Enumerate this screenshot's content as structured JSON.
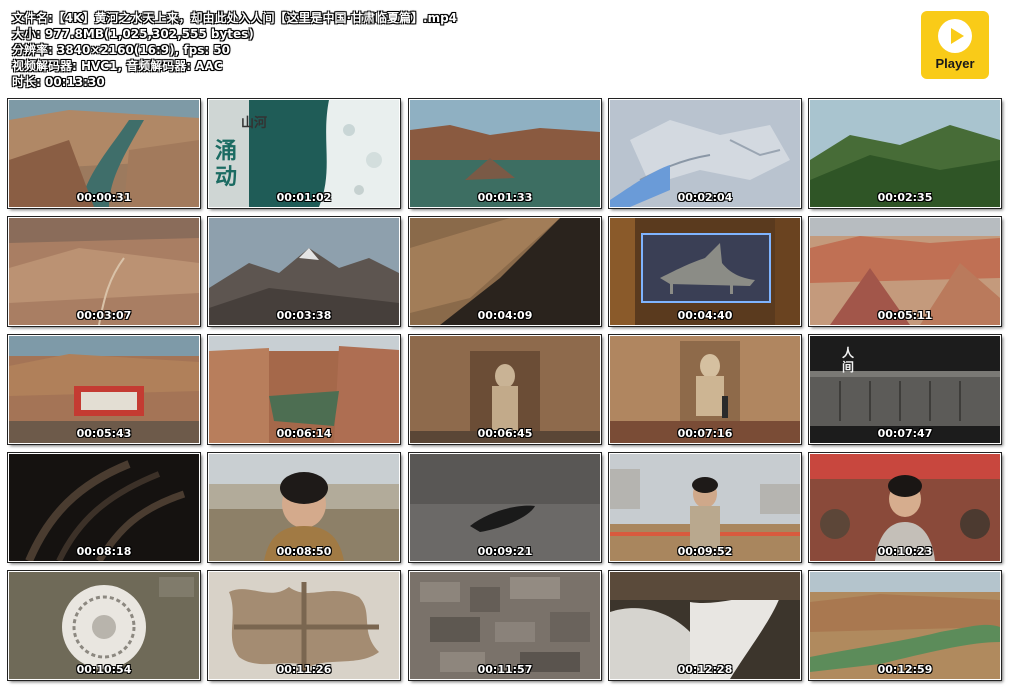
{
  "info": {
    "filename": "文件名:【4K】黄河之水天上来，却由此处入人间【这里是中国·甘肃临夏篇】.mp4",
    "size": "大小: 977.8MB(1,025,302,555 bytes)",
    "resolution": "分辨率: 3840×2160(16:9), fps: 50",
    "codec": "视频解码器: HVC1, 音频解码器: AAC",
    "duration": "时长: 00:13:30"
  },
  "logo": {
    "text": "Player",
    "color": "#f9cb18"
  },
  "thumbnails": [
    {
      "time": "00:00:31"
    },
    {
      "time": "00:01:02",
      "caption": "山河",
      "caption2": "涌动"
    },
    {
      "time": "00:01:33"
    },
    {
      "time": "00:02:04"
    },
    {
      "time": "00:02:35"
    },
    {
      "time": "00:03:07"
    },
    {
      "time": "00:03:38"
    },
    {
      "time": "00:04:09"
    },
    {
      "time": "00:04:40"
    },
    {
      "time": "00:05:11"
    },
    {
      "time": "00:05:43"
    },
    {
      "time": "00:06:14"
    },
    {
      "time": "00:06:45"
    },
    {
      "time": "00:07:16"
    },
    {
      "time": "00:07:47",
      "caption": "人间"
    },
    {
      "time": "00:08:18"
    },
    {
      "time": "00:08:50"
    },
    {
      "time": "00:09:21"
    },
    {
      "time": "00:09:52"
    },
    {
      "time": "00:10:23"
    },
    {
      "time": "00:10:54"
    },
    {
      "time": "00:11:26"
    },
    {
      "time": "00:11:57"
    },
    {
      "time": "00:12:28"
    },
    {
      "time": "00:12:59"
    }
  ]
}
